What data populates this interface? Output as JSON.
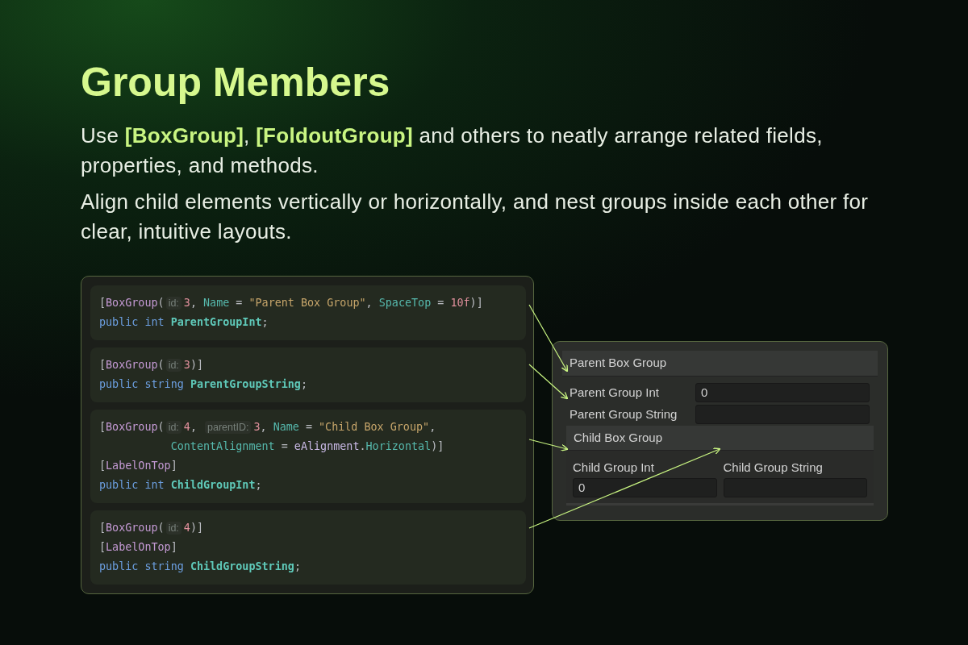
{
  "heading": "Group Members",
  "paragraphs": [
    "Use **[BoxGroup]**, **[FoldoutGroup]** and others to neatly arrange related fields, properties, and methods.",
    "Align child elements vertically or horizontally, and nest groups inside each other for clear, intuitive layouts."
  ],
  "code_blocks": [
    {
      "lines": [
        [
          {
            "kind": "punct",
            "text": "["
          },
          {
            "kind": "attr",
            "text": "BoxGroup"
          },
          {
            "kind": "punct",
            "text": "("
          },
          {
            "kind": "hint",
            "text": "id:"
          },
          {
            "kind": "number",
            "text": "3"
          },
          {
            "kind": "punct",
            "text": ", "
          },
          {
            "kind": "prop",
            "text": "Name"
          },
          {
            "kind": "punct",
            "text": " = "
          },
          {
            "kind": "string",
            "text": "\"Parent Box Group\""
          },
          {
            "kind": "punct",
            "text": ", "
          },
          {
            "kind": "prop",
            "text": "SpaceTop"
          },
          {
            "kind": "punct",
            "text": " = "
          },
          {
            "kind": "number",
            "text": "10f"
          },
          {
            "kind": "punct",
            "text": ")]"
          }
        ],
        [
          {
            "kind": "keyword",
            "text": "public int "
          },
          {
            "kind": "field",
            "text": "ParentGroupInt"
          },
          {
            "kind": "punct",
            "text": ";"
          }
        ]
      ]
    },
    {
      "lines": [
        [
          {
            "kind": "punct",
            "text": "["
          },
          {
            "kind": "attr",
            "text": "BoxGroup"
          },
          {
            "kind": "punct",
            "text": "("
          },
          {
            "kind": "hint",
            "text": "id:"
          },
          {
            "kind": "number",
            "text": "3"
          },
          {
            "kind": "punct",
            "text": ")]"
          }
        ],
        [
          {
            "kind": "keyword",
            "text": "public string "
          },
          {
            "kind": "field",
            "text": "ParentGroupString"
          },
          {
            "kind": "punct",
            "text": ";"
          }
        ]
      ]
    },
    {
      "lines": [
        [
          {
            "kind": "punct",
            "text": "["
          },
          {
            "kind": "attr",
            "text": "BoxGroup"
          },
          {
            "kind": "punct",
            "text": "("
          },
          {
            "kind": "hint",
            "text": "id:"
          },
          {
            "kind": "number",
            "text": "4"
          },
          {
            "kind": "punct",
            "text": ", "
          },
          {
            "kind": "hint",
            "text": "parentID:"
          },
          {
            "kind": "number",
            "text": "3"
          },
          {
            "kind": "punct",
            "text": ", "
          },
          {
            "kind": "prop",
            "text": "Name"
          },
          {
            "kind": "punct",
            "text": " = "
          },
          {
            "kind": "string",
            "text": "\"Child Box Group\""
          },
          {
            "kind": "punct",
            "text": ","
          }
        ],
        [
          {
            "kind": "indent"
          },
          {
            "kind": "prop",
            "text": "ContentAlignment"
          },
          {
            "kind": "punct",
            "text": " = "
          },
          {
            "kind": "type",
            "text": "eAlignment"
          },
          {
            "kind": "punct",
            "text": "."
          },
          {
            "kind": "prop",
            "text": "Horizontal"
          },
          {
            "kind": "punct",
            "text": ")]"
          }
        ],
        [
          {
            "kind": "punct",
            "text": "["
          },
          {
            "kind": "attr",
            "text": "LabelOnTop"
          },
          {
            "kind": "punct",
            "text": "]"
          }
        ],
        [
          {
            "kind": "keyword",
            "text": "public int "
          },
          {
            "kind": "field",
            "text": "ChildGroupInt"
          },
          {
            "kind": "punct",
            "text": ";"
          }
        ]
      ]
    },
    {
      "lines": [
        [
          {
            "kind": "punct",
            "text": "["
          },
          {
            "kind": "attr",
            "text": "BoxGroup"
          },
          {
            "kind": "punct",
            "text": "("
          },
          {
            "kind": "hint",
            "text": "id:"
          },
          {
            "kind": "number",
            "text": "4"
          },
          {
            "kind": "punct",
            "text": ")]"
          }
        ],
        [
          {
            "kind": "punct",
            "text": "["
          },
          {
            "kind": "attr",
            "text": "LabelOnTop"
          },
          {
            "kind": "punct",
            "text": "]"
          }
        ],
        [
          {
            "kind": "keyword",
            "text": "public string "
          },
          {
            "kind": "field",
            "text": "ChildGroupString"
          },
          {
            "kind": "punct",
            "text": ";"
          }
        ]
      ]
    }
  ],
  "inspector": {
    "title": "Parent Box Group",
    "fields": [
      {
        "kind": "row",
        "label": "Parent Group Int",
        "value": "0"
      },
      {
        "kind": "row",
        "label": "Parent Group String"
      }
    ],
    "child_group": {
      "title": "Child Box Group",
      "fields": [
        {
          "kind": "top",
          "label": "Child Group Int",
          "value": "0"
        },
        {
          "kind": "top",
          "label": "Child Group String"
        }
      ]
    }
  }
}
